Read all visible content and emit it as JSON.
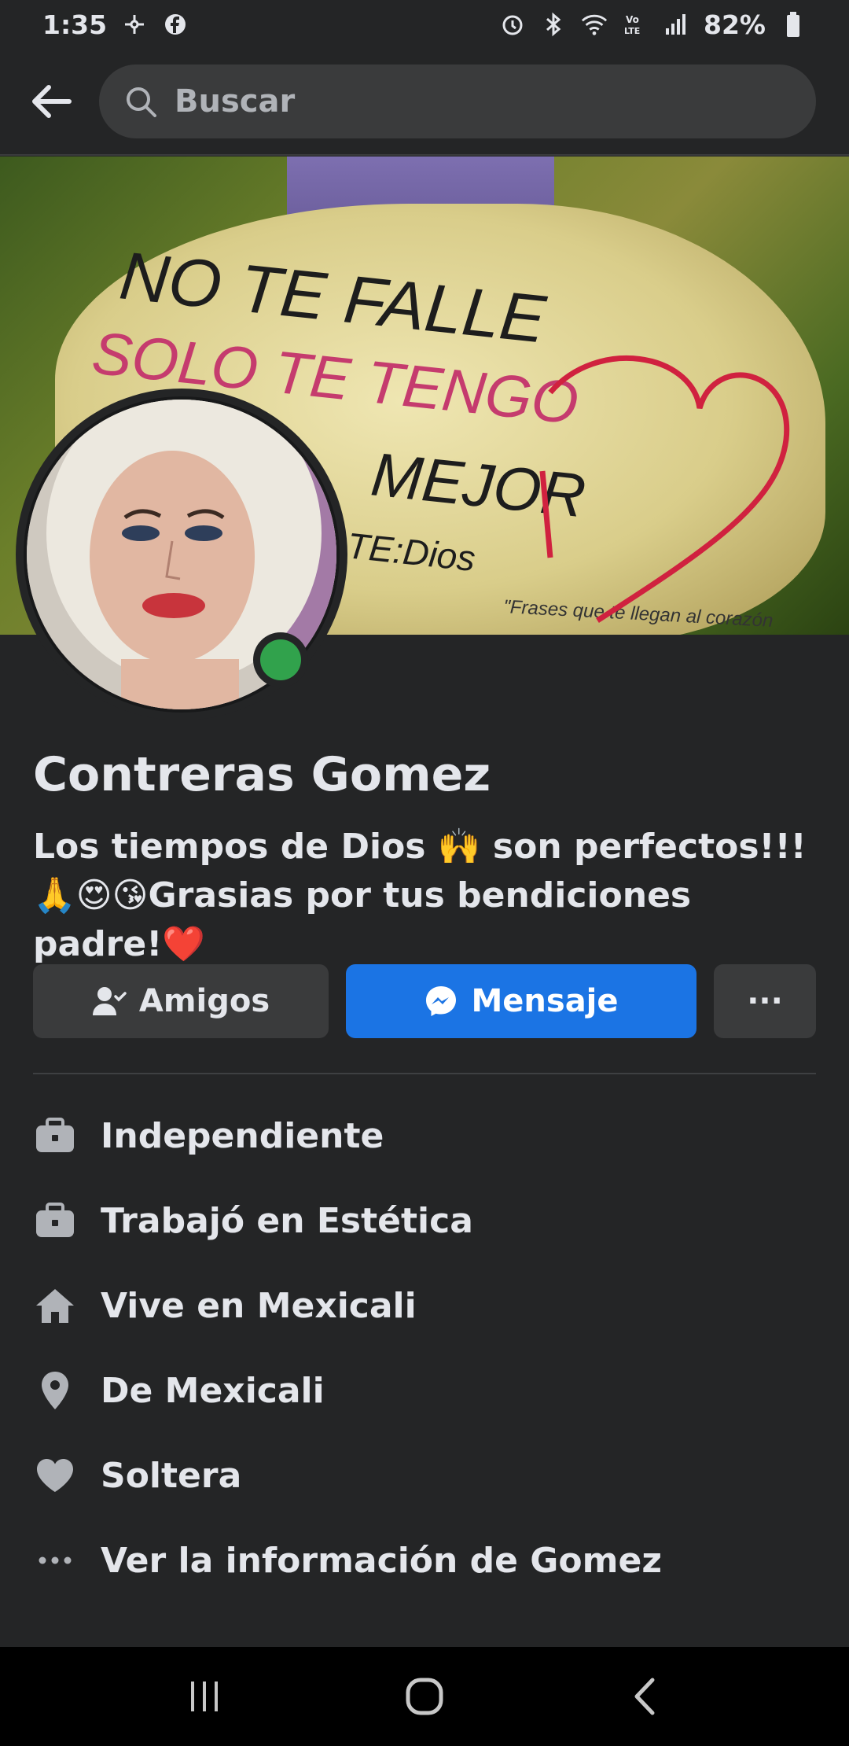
{
  "status_bar": {
    "time": "1:35",
    "battery": "82%",
    "icons": [
      "pinwheel-icon",
      "facebook-icon",
      "alarm-icon",
      "bluetooth-icon",
      "wifi-icon",
      "volte-icon",
      "signal-icon",
      "battery-icon"
    ]
  },
  "header": {
    "back_icon": "arrow-left-icon",
    "search_placeholder": "Buscar",
    "search_icon": "search-icon"
  },
  "profile": {
    "name": "Contreras Gomez",
    "bio": "Los tiempos de Dios 🙌 son perfectos!!!🙏😍😘Grasias por tus bendiciones padre!❤️",
    "online": true
  },
  "cover_text": {
    "line1": "NO TE FALLE",
    "line2": "SOLO TE TENGO",
    "line3": "MEJOR",
    "line4": "TE:Dios",
    "line5": "\"Frases que te llegan al corazón"
  },
  "actions": {
    "friends_label": "Amigos",
    "message_label": "Mensaje",
    "more_label": "···"
  },
  "details": [
    {
      "icon": "briefcase-icon",
      "text": "Independiente"
    },
    {
      "icon": "briefcase-icon",
      "text": "Trabajó en Estética"
    },
    {
      "icon": "home-icon",
      "text": "Vive en Mexicali"
    },
    {
      "icon": "location-pin-icon",
      "text": "De Mexicali"
    },
    {
      "icon": "heart-icon",
      "text": "Soltera"
    },
    {
      "icon": "more-dots-icon",
      "text": "Ver la información de Gomez"
    }
  ],
  "colors": {
    "background": "#242526",
    "primary": "#1b74e4",
    "surface": "#3a3b3c",
    "online": "#31a24c",
    "text": "#e4e6eb"
  }
}
